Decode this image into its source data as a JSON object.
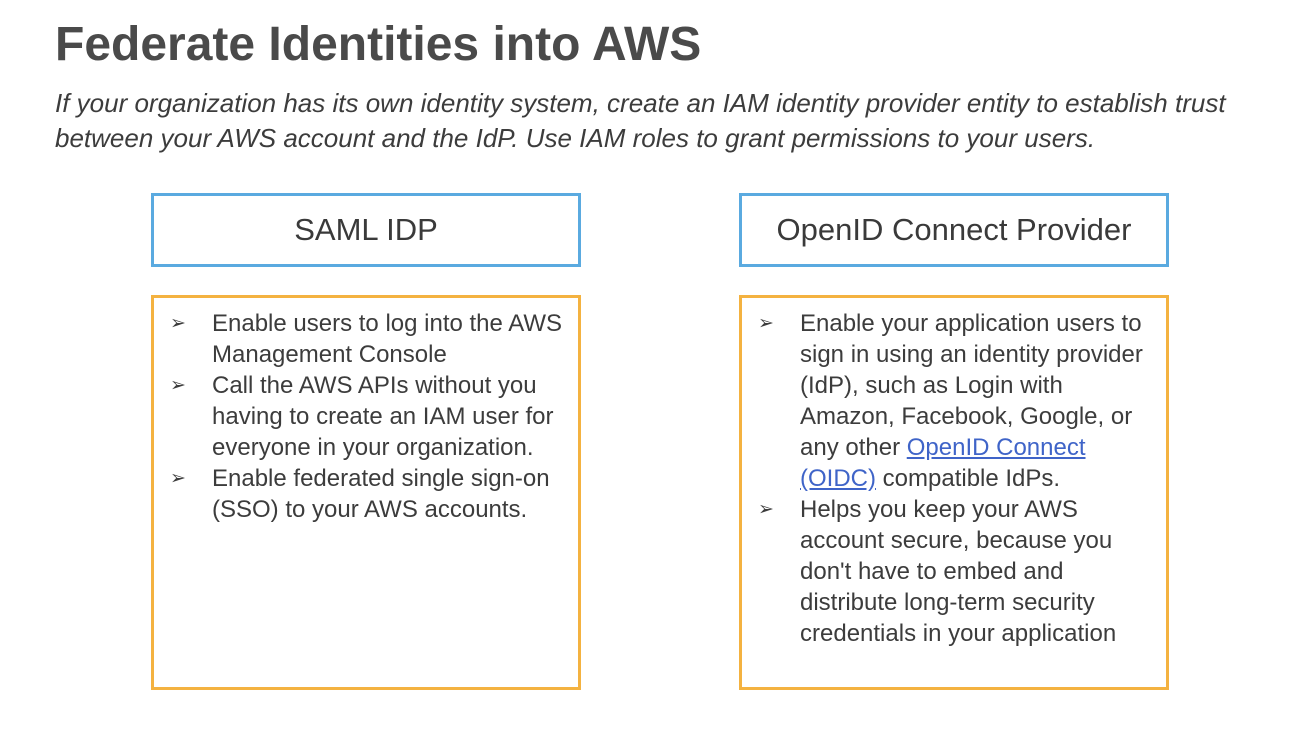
{
  "title": "Federate Identities into AWS",
  "subtitle": "If your organization has its own identity system, create an IAM identity provider entity to establish trust between your AWS account and the IdP. Use IAM roles to grant permissions to your users.",
  "bullet_icon": "arrow-bullet-icon",
  "bullet_glyph": "➢",
  "colors": {
    "header_border": "#5aaae0",
    "content_border": "#f4b240",
    "link": "#3f64c8"
  },
  "saml": {
    "header": "SAML IDP",
    "items": [
      "Enable users to log into the AWS Management Console",
      "Call the AWS APIs without you having to create an IAM user for everyone in your organization.",
      "Enable federated single sign-on (SSO) to your AWS accounts."
    ]
  },
  "oidc": {
    "header": "OpenID Connect Provider",
    "item1": {
      "before": "Enable your application users to sign in using an identity provider (IdP), such as Login with Amazon, Facebook, Google, or any other ",
      "link": "OpenID Connect (OIDC)",
      "after": " compatible IdPs."
    },
    "item2": "Helps you keep your AWS account secure, because you don't have to embed and distribute long-term security credentials in your application"
  }
}
